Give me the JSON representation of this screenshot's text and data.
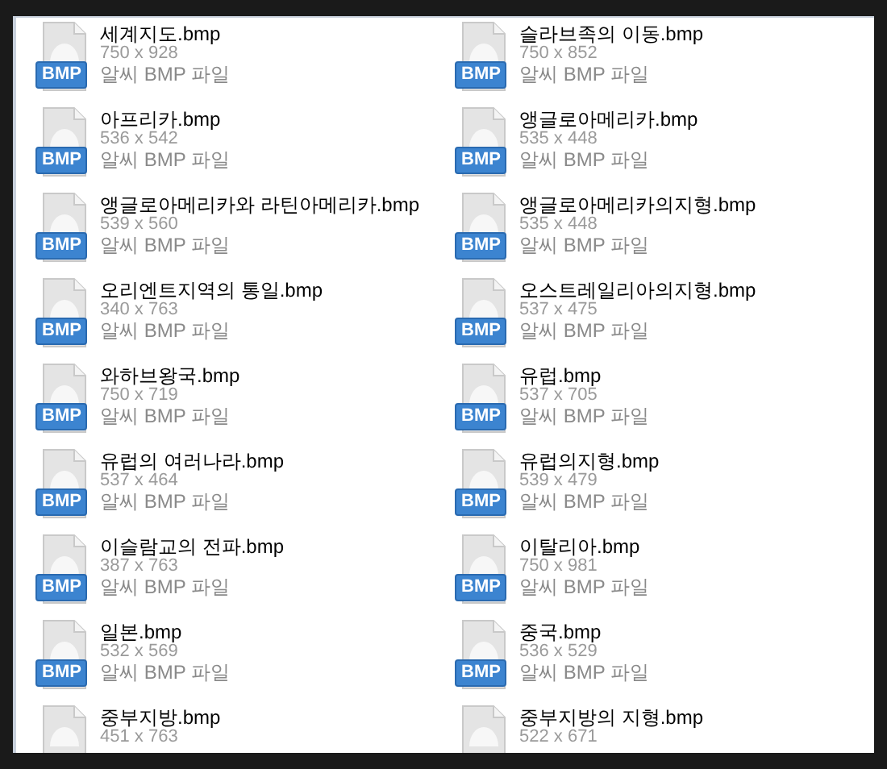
{
  "files": [
    {
      "name": "세계지도.bmp",
      "size": "750 x 928",
      "type": "알씨 BMP 파일",
      "badge": "BMP"
    },
    {
      "name": "슬라브족의 이동.bmp",
      "size": "750 x 852",
      "type": "알씨 BMP 파일",
      "badge": "BMP"
    },
    {
      "name": "아프리카.bmp",
      "size": "536 x 542",
      "type": "알씨 BMP 파일",
      "badge": "BMP"
    },
    {
      "name": "앵글로아메리카.bmp",
      "size": "535 x 448",
      "type": "알씨 BMP 파일",
      "badge": "BMP"
    },
    {
      "name": "앵글로아메리카와 라틴아메리카.bmp",
      "size": "539 x 560",
      "type": "알씨 BMP 파일",
      "badge": "BMP"
    },
    {
      "name": "앵글로아메리카의지형.bmp",
      "size": "535 x 448",
      "type": "알씨 BMP 파일",
      "badge": "BMP"
    },
    {
      "name": "오리엔트지역의 통일.bmp",
      "size": "340 x 763",
      "type": "알씨 BMP 파일",
      "badge": "BMP"
    },
    {
      "name": "오스트레일리아의지형.bmp",
      "size": "537 x 475",
      "type": "알씨 BMP 파일",
      "badge": "BMP"
    },
    {
      "name": "와하브왕국.bmp",
      "size": "750 x 719",
      "type": "알씨 BMP 파일",
      "badge": "BMP"
    },
    {
      "name": "유럽.bmp",
      "size": "537 x 705",
      "type": "알씨 BMP 파일",
      "badge": "BMP"
    },
    {
      "name": "유럽의 여러나라.bmp",
      "size": "537 x 464",
      "type": "알씨 BMP 파일",
      "badge": "BMP"
    },
    {
      "name": "유럽의지형.bmp",
      "size": "539 x 479",
      "type": "알씨 BMP 파일",
      "badge": "BMP"
    },
    {
      "name": "이슬람교의 전파.bmp",
      "size": "387 x 763",
      "type": "알씨 BMP 파일",
      "badge": "BMP"
    },
    {
      "name": "이탈리아.bmp",
      "size": "750 x 981",
      "type": "알씨 BMP 파일",
      "badge": "BMP"
    },
    {
      "name": "일본.bmp",
      "size": "532 x 569",
      "type": "알씨 BMP 파일",
      "badge": "BMP"
    },
    {
      "name": "중국.bmp",
      "size": "536 x 529",
      "type": "알씨 BMP 파일",
      "badge": "BMP"
    },
    {
      "name": "중부지방.bmp",
      "size": "451 x 763"
    },
    {
      "name": "중부지방의 지형.bmp",
      "size": "522 x 671"
    }
  ]
}
